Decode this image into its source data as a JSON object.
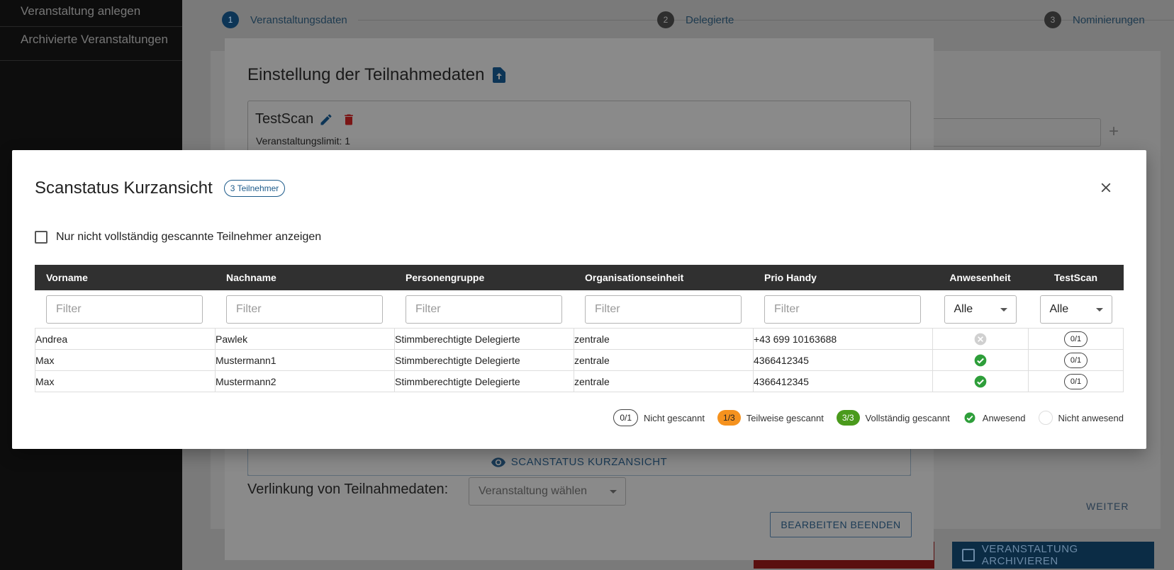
{
  "sidebar": {
    "items": [
      {
        "label": "Veranstaltung anlegen"
      },
      {
        "label": "Archivierte Veranstaltungen"
      }
    ]
  },
  "stepper": {
    "steps": [
      {
        "num": "1",
        "label": "Veranstaltungsdaten"
      },
      {
        "num": "2",
        "label": "Delegierte"
      },
      {
        "num": "3",
        "label": "Nominierungen"
      }
    ]
  },
  "background": {
    "weiter_label": "WEITER",
    "archive_label": "VERANSTALTUNG ARCHIVIEREN",
    "plus": "+"
  },
  "mid_dialog": {
    "title": "Einstellung der Teilnahmedaten",
    "scan_name": "TestScan",
    "limit_text": "Veranstaltungslimit: 1",
    "scanstatus_button": "SCANSTATUS KURZANSICHT",
    "link_label": "Verlinkung von Teilnahmedaten:",
    "link_placeholder": "Veranstaltung wählen",
    "end_button": "BEARBEITEN BEENDEN"
  },
  "modal": {
    "title": "Scanstatus Kurzansicht",
    "count_badge": "3 Teilnehmer",
    "checkbox_label": "Nur nicht vollständig gescannte Teilnehmer anzeigen",
    "columns": [
      "Vorname",
      "Nachname",
      "Personengruppe",
      "Organisationseinheit",
      "Prio Handy",
      "Anwesenheit",
      "TestScan"
    ],
    "filter_placeholder": "Filter",
    "select_value": "Alle",
    "rows": [
      {
        "vorname": "Andrea",
        "nachname": "Pawlek",
        "gruppe": "Stimmberechtigte Delegierte",
        "org": "zentrale",
        "handy": "+43 699 10163688",
        "anwesend": "not-present",
        "scan": "0/1"
      },
      {
        "vorname": "Max",
        "nachname": "Mustermann1",
        "gruppe": "Stimmberechtigte Delegierte",
        "org": "zentrale",
        "handy": "4366412345",
        "anwesend": "present",
        "scan": "0/1"
      },
      {
        "vorname": "Max",
        "nachname": "Mustermann2",
        "gruppe": "Stimmberechtigte Delegierte",
        "org": "zentrale",
        "handy": "4366412345",
        "anwesend": "present",
        "scan": "0/1"
      }
    ],
    "legend": {
      "not_scanned_pill": "0/1",
      "not_scanned": "Nicht gescannt",
      "partial_pill": "1/3",
      "partial": "Teilweise gescannt",
      "full_pill": "3/3",
      "full": "Vollständig gescannt",
      "present": "Anwesend",
      "not_present": "Nicht anwesend"
    }
  },
  "colors": {
    "accent": "#1c5a8a",
    "present_green": "#2e9e3a",
    "partial_orange": "#f5921e",
    "full_green": "#4a9a1c",
    "header_dark": "#303030"
  }
}
